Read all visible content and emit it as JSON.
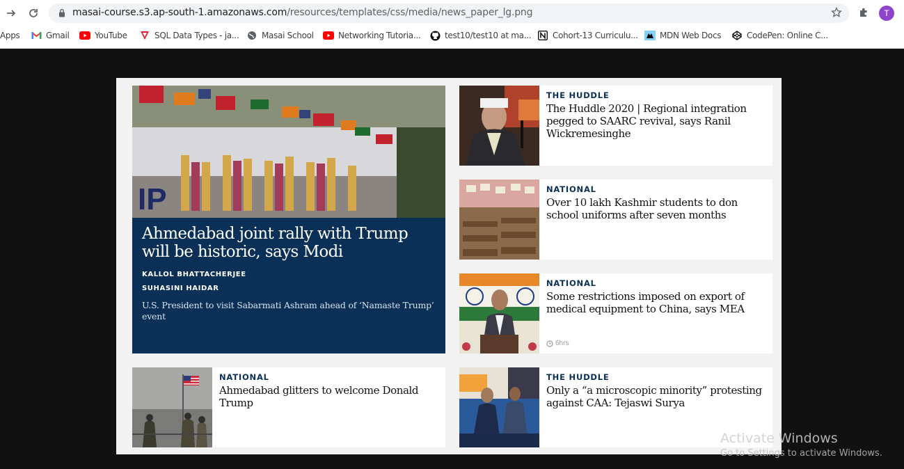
{
  "browser": {
    "url_host": "masai-course.s3.ap-south-1.amazonaws.com",
    "url_path": "/resources/templates/css/media/news_paper_lg.png",
    "profile_initial": "T",
    "bookmarks": [
      {
        "label": "Apps",
        "icon": "apps-icon"
      },
      {
        "label": "Gmail",
        "icon": "gmail-icon"
      },
      {
        "label": "YouTube",
        "icon": "youtube-icon"
      },
      {
        "label": "SQL Data Types - ja...",
        "icon": "sql-icon"
      },
      {
        "label": "Masai School",
        "icon": "globe-icon"
      },
      {
        "label": "Networking Tutoria...",
        "icon": "youtube-icon"
      },
      {
        "label": "test10/test10 at ma...",
        "icon": "github-icon"
      },
      {
        "label": "Cohort-13 Curriculu...",
        "icon": "notion-icon"
      },
      {
        "label": "MDN Web Docs",
        "icon": "mdn-icon"
      },
      {
        "label": "CodePen: Online C...",
        "icon": "codepen-icon"
      }
    ]
  },
  "lead": {
    "title": "Ahmedabad joint rally with Trump will be historic, says Modi",
    "authors": [
      "KALLOL BHATTACHERJEE",
      "SUHASINI HAIDAR"
    ],
    "description": "U.S. President to visit Sabarmati Ashram ahead of ‘Namaste Trump’ event"
  },
  "cards": [
    {
      "category": "THE HUDDLE",
      "headline": "The Huddle 2020 | Regional integration pegged to SAARC revival, says Ranil Wickremesinghe",
      "time": ""
    },
    {
      "category": "NATIONAL",
      "headline": "Over 10 lakh Kashmir students to don school uniforms after seven months",
      "time": ""
    },
    {
      "category": "NATIONAL",
      "headline": "Some restrictions imposed on export of medical equipment to China, says MEA",
      "time": "6hrs"
    },
    {
      "category": "NATIONAL",
      "headline": "Ahmedabad glitters to welcome Donald Trump",
      "time": ""
    },
    {
      "category": "THE HUDDLE",
      "headline": "Only a “a microscopic minority” protesting against CAA: Tejaswi Surya",
      "time": ""
    }
  ],
  "watermark": {
    "title": "Activate Windows",
    "subtitle": "Go to Settings to activate Windows."
  },
  "colors": {
    "navy": "#0a3057",
    "page_background": "#111111",
    "card_background": "#ffffff"
  }
}
